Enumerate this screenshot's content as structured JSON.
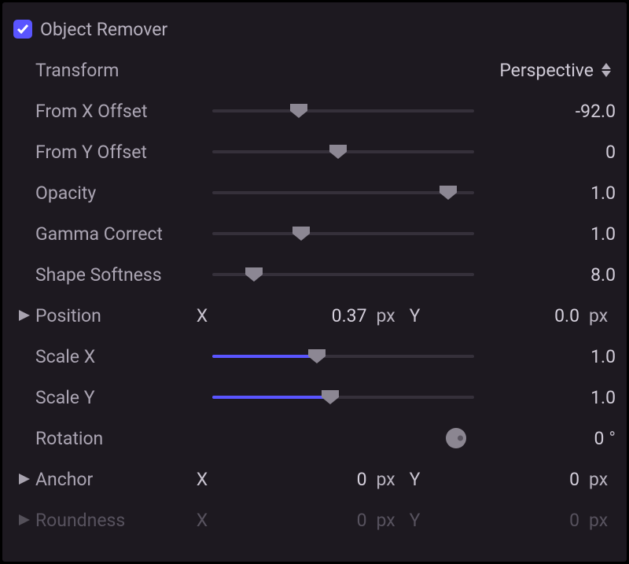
{
  "header": {
    "title": "Object Remover",
    "checked": true
  },
  "transform": {
    "label": "Transform",
    "value": "Perspective"
  },
  "sliders": {
    "fromX": {
      "label": "From X Offset",
      "value": "-92.0",
      "percent": 33
    },
    "fromY": {
      "label": "From Y Offset",
      "value": "0",
      "percent": 48
    },
    "opacity": {
      "label": "Opacity",
      "value": "1.0",
      "percent": 90
    },
    "gamma": {
      "label": "Gamma Correct",
      "value": "1.0",
      "percent": 34
    },
    "softness": {
      "label": "Shape Softness",
      "value": "8.0",
      "percent": 16
    },
    "scaleX": {
      "label": "Scale X",
      "value": "1.0",
      "percent": 40,
      "fill": 40
    },
    "scaleY": {
      "label": "Scale Y",
      "value": "1.0",
      "percent": 45,
      "fill": 45
    }
  },
  "position": {
    "label": "Position",
    "x": "0.37",
    "y": "0.0",
    "unit": "px"
  },
  "rotation": {
    "label": "Rotation",
    "value": "0",
    "unit": "°"
  },
  "anchor": {
    "label": "Anchor",
    "x": "0",
    "y": "0",
    "unit": "px"
  },
  "roundness": {
    "label": "Roundness",
    "x": "0",
    "y": "0",
    "unit": "px"
  }
}
